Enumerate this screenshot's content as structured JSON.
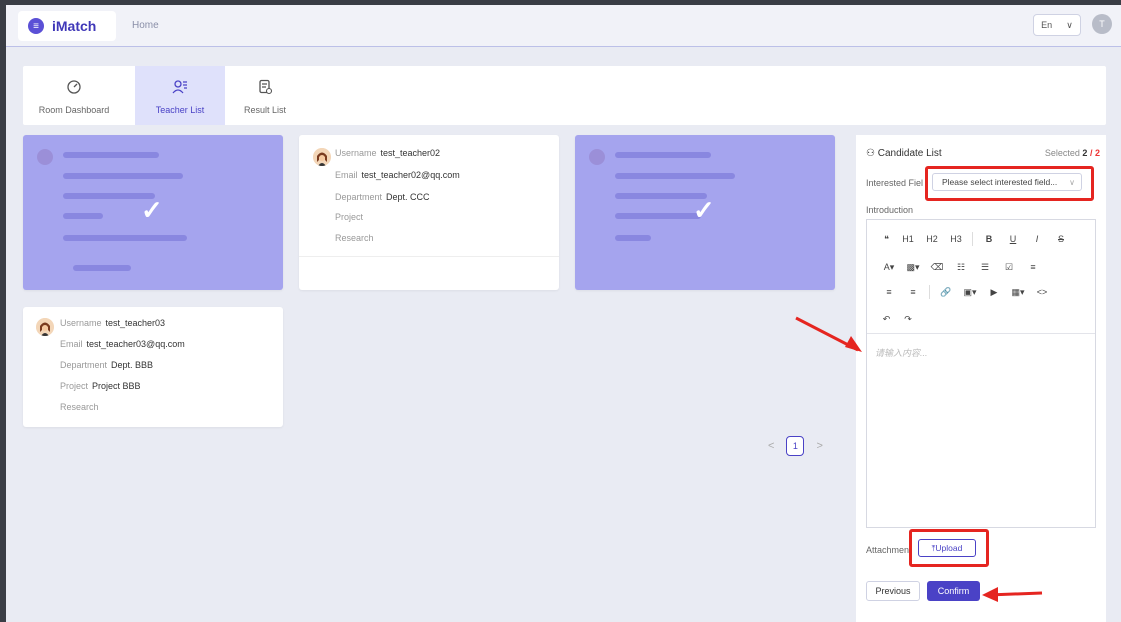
{
  "app": {
    "logo_text": "iMatch",
    "home_link": "Home",
    "language": "En",
    "user_initial": "T"
  },
  "tabs": [
    {
      "label": "Room Dashboard",
      "icon": "dashboard-icon",
      "active": false
    },
    {
      "label": "Teacher List",
      "icon": "users-list-icon",
      "active": true
    },
    {
      "label": "Result List",
      "icon": "result-doc-icon",
      "active": false
    }
  ],
  "labels": {
    "username": "Username",
    "email": "Email",
    "department": "Department",
    "project": "Project",
    "research": "Research"
  },
  "teachers": [
    {
      "username": "test_teacher02",
      "email": "test_teacher02@qq.com",
      "department": "Dept. CCC",
      "project": "",
      "research": ""
    },
    {
      "username": "test_teacher03",
      "email": "test_teacher03@qq.com",
      "department": "Dept. BBB",
      "project": "Project BBB",
      "research": ""
    }
  ],
  "pagination": {
    "current": "1",
    "prev": "<",
    "next": ">"
  },
  "panel": {
    "title": "Candidate List",
    "selected_label": "Selected",
    "selected_count": "2",
    "selected_sep": "/",
    "selected_total": "2",
    "interested_field_label": "Interested Fiel",
    "interested_field_placeholder": "Please select interested field...",
    "introduction_label": "Introduction",
    "editor_placeholder": "请输入内容...",
    "attachment_label": "Attachmen",
    "upload_label": "⤒Upload",
    "previous_label": "Previous",
    "confirm_label": "Confirm"
  },
  "toolbar": {
    "row1": [
      "❝",
      "H1",
      "H2",
      "H3",
      "B",
      "U",
      "I",
      "S"
    ],
    "row2": [
      "A▾",
      "▩▾",
      "⌫",
      "☷",
      "☰",
      "☑",
      "≡"
    ],
    "row3": [
      "≡",
      "≡",
      "🔗",
      "▣▾",
      "▶",
      "▦▾",
      "<>"
    ],
    "row4": [
      "↶",
      "↷"
    ]
  },
  "colors": {
    "accent": "#4a42c6",
    "selected_card": "#a5a4ee",
    "annotation_red": "#e52520"
  }
}
